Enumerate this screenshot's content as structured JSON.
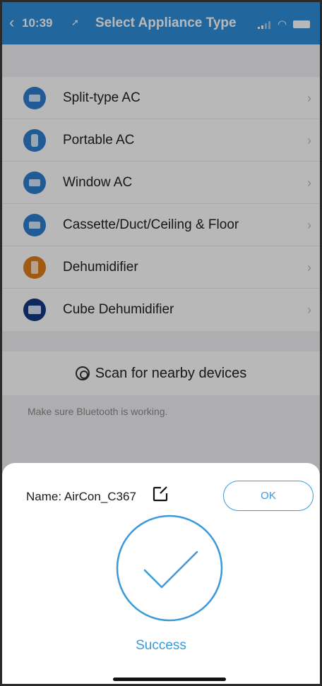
{
  "status_bar": {
    "time": "10:39",
    "location_glyph": "➚"
  },
  "navbar": {
    "back_glyph": "‹",
    "title": "Select Appliance Type"
  },
  "appliances": [
    {
      "label": "Split-type AC",
      "icon": "split-ac-icon"
    },
    {
      "label": "Portable AC",
      "icon": "portable-ac-icon"
    },
    {
      "label": "Window AC",
      "icon": "window-ac-icon"
    },
    {
      "label": "Cassette/Duct/Ceiling & Floor",
      "icon": "cassette-ac-icon"
    },
    {
      "label": "Dehumidifier",
      "icon": "dehumidifier-icon"
    },
    {
      "label": "Cube Dehumidifier",
      "icon": "cube-dehumidifier-icon"
    }
  ],
  "chevron": "›",
  "scan": {
    "label": "Scan for nearby devices"
  },
  "hint": "Make sure Bluetooth is working.",
  "sheet": {
    "name_label": "Name: AirCon_C367",
    "ok_label": "OK",
    "status": "Success"
  },
  "colors": {
    "accent": "#3a9ad9",
    "navbar": "#2f8fdc"
  }
}
